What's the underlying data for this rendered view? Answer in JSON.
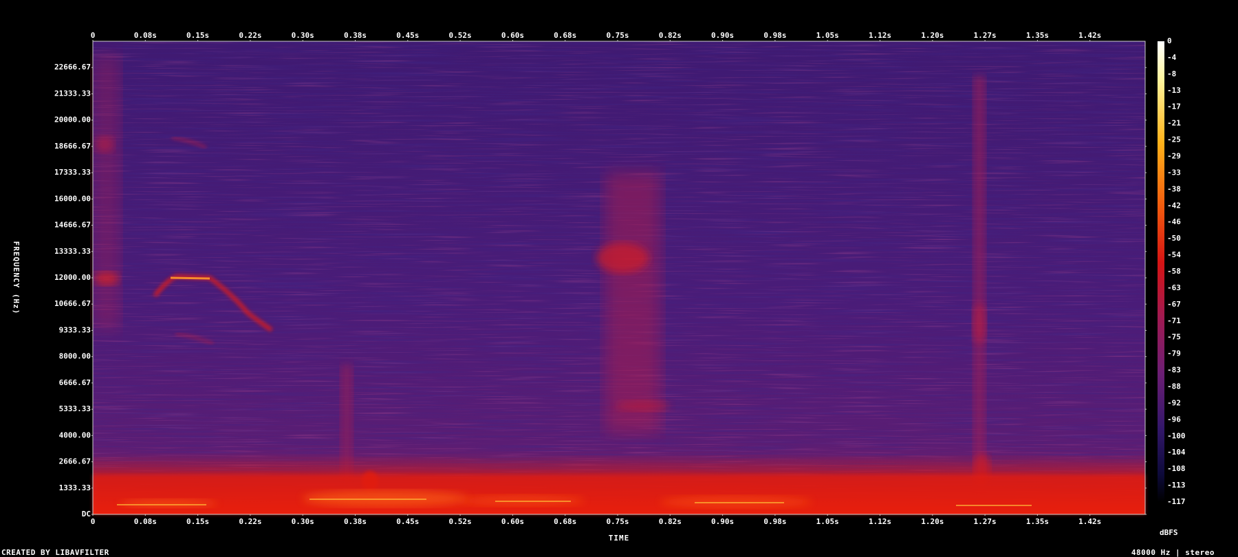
{
  "chart_data": {
    "type": "heatmap",
    "xlabel": "TIME",
    "ylabel": "FREQUENCY (Hz)",
    "x_ticks": [
      "0",
      "0.08s",
      "0.15s",
      "0.22s",
      "0.30s",
      "0.38s",
      "0.45s",
      "0.52s",
      "0.60s",
      "0.68s",
      "0.75s",
      "0.82s",
      "0.90s",
      "0.98s",
      "1.05s",
      "1.12s",
      "1.20s",
      "1.27s",
      "1.35s",
      "1.42s"
    ],
    "y_ticks": [
      "DC",
      "1333.33",
      "2666.67",
      "4000.00",
      "5333.33",
      "6666.67",
      "8000.00",
      "9333.33",
      "10666.67",
      "12000.00",
      "13333.33",
      "14666.67",
      "16000.00",
      "17333.33",
      "18666.67",
      "20000.00",
      "21333.33",
      "22666.67"
    ],
    "y_tick_values": [
      0,
      1333.33,
      2666.67,
      4000,
      5333.33,
      6666.67,
      8000,
      9333.33,
      10666.67,
      12000,
      13333.33,
      14666.67,
      16000,
      17333.33,
      18666.67,
      20000,
      21333.33,
      22666.67
    ],
    "x_range": [
      0,
      1.49
    ],
    "y_range": [
      0,
      24000
    ],
    "colorbar": {
      "unit": "dBFS",
      "ticks": [
        "0",
        "-4",
        "-8",
        "-13",
        "-17",
        "-21",
        "-25",
        "-29",
        "-33",
        "-38",
        "-42",
        "-46",
        "-50",
        "-54",
        "-58",
        "-63",
        "-67",
        "-71",
        "-75",
        "-79",
        "-83",
        "-88",
        "-92",
        "-96",
        "-100",
        "-104",
        "-108",
        "-113",
        "-117"
      ],
      "range": [
        -120,
        0
      ]
    },
    "colors": {
      "background": "#000000",
      "noise_floor": "#4a1c78",
      "mid": "#8a1f6e",
      "hot": "#e8190a",
      "peak": "#ffd23a",
      "max": "#ffffff"
    },
    "grid": false
  },
  "footer": {
    "left": "CREATED BY LIBAVFILTER",
    "right": "48000 Hz | stereo"
  }
}
